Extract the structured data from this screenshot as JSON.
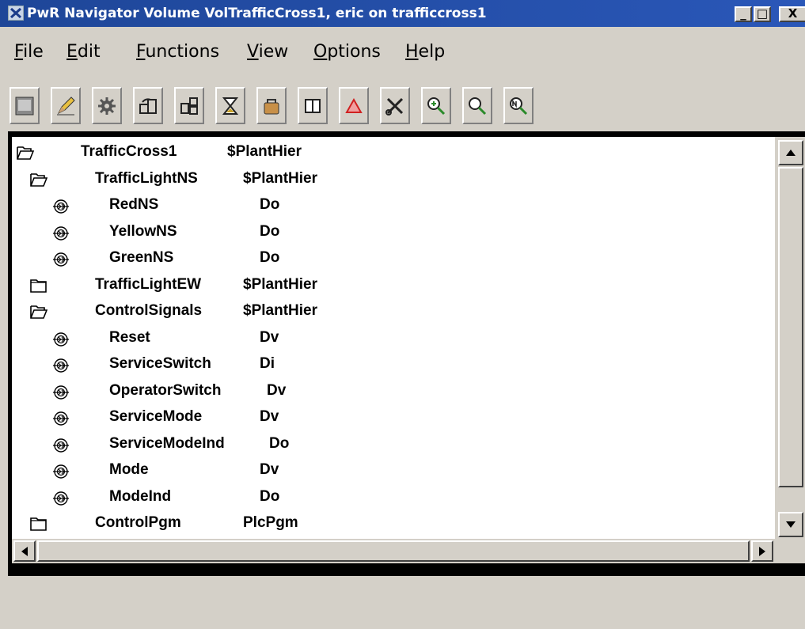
{
  "window": {
    "title": "PwR Navigator Volume VolTrafficCross1, eric on trafficcross1",
    "min_label": "_",
    "max_label": "□",
    "close_label": "X"
  },
  "menubar": {
    "items": [
      {
        "mnemonic": "F",
        "rest": "ile"
      },
      {
        "mnemonic": "E",
        "rest": "dit"
      },
      {
        "mnemonic": "F",
        "rest": "unctions"
      },
      {
        "mnemonic": "V",
        "rest": "iew"
      },
      {
        "mnemonic": "O",
        "rest": "ptions"
      },
      {
        "mnemonic": "H",
        "rest": "elp"
      }
    ]
  },
  "toolbar": {
    "buttons": [
      "save-icon",
      "edit-pencil-icon",
      "gear-icon",
      "open-object-icon",
      "copy-structure-icon",
      "hourglass-icon",
      "package-icon",
      "columns-icon",
      "triangle-alert-icon",
      "scissors-icon",
      "zoom-in-icon",
      "zoom-icon",
      "zoom-reset-icon"
    ]
  },
  "tree": {
    "rows": [
      {
        "icon": "open-folder",
        "name": "TrafficCross1",
        "cls": "$PlantHier",
        "level": 0
      },
      {
        "icon": "open-folder",
        "name": "TrafficLightNS",
        "cls": "$PlantHier",
        "level": 1
      },
      {
        "icon": "signal",
        "name": "RedNS",
        "cls": "Do",
        "level": 2
      },
      {
        "icon": "signal",
        "name": "YellowNS",
        "cls": "Do",
        "level": 2
      },
      {
        "icon": "signal",
        "name": "GreenNS",
        "cls": "Do",
        "level": 2
      },
      {
        "icon": "closed-folder",
        "name": "TrafficLightEW",
        "cls": "$PlantHier",
        "level": 1
      },
      {
        "icon": "open-folder",
        "name": "ControlSignals",
        "cls": "$PlantHier",
        "level": 1
      },
      {
        "icon": "signal",
        "name": "Reset",
        "cls": "Dv",
        "level": 2
      },
      {
        "icon": "signal",
        "name": "ServiceSwitch",
        "cls": "Di",
        "level": 2
      },
      {
        "icon": "signal",
        "name": "OperatorSwitch",
        "cls": "Dv",
        "level": 2
      },
      {
        "icon": "signal",
        "name": "ServiceMode",
        "cls": "Dv",
        "level": 2
      },
      {
        "icon": "signal",
        "name": "ServiceModeInd",
        "cls": "Do",
        "level": 2
      },
      {
        "icon": "signal",
        "name": "Mode",
        "cls": "Dv",
        "level": 2
      },
      {
        "icon": "signal",
        "name": "ModeInd",
        "cls": "Do",
        "level": 2
      },
      {
        "icon": "closed-folder",
        "name": "ControlPgm",
        "cls": "PlcPgm",
        "level": 1
      }
    ]
  }
}
